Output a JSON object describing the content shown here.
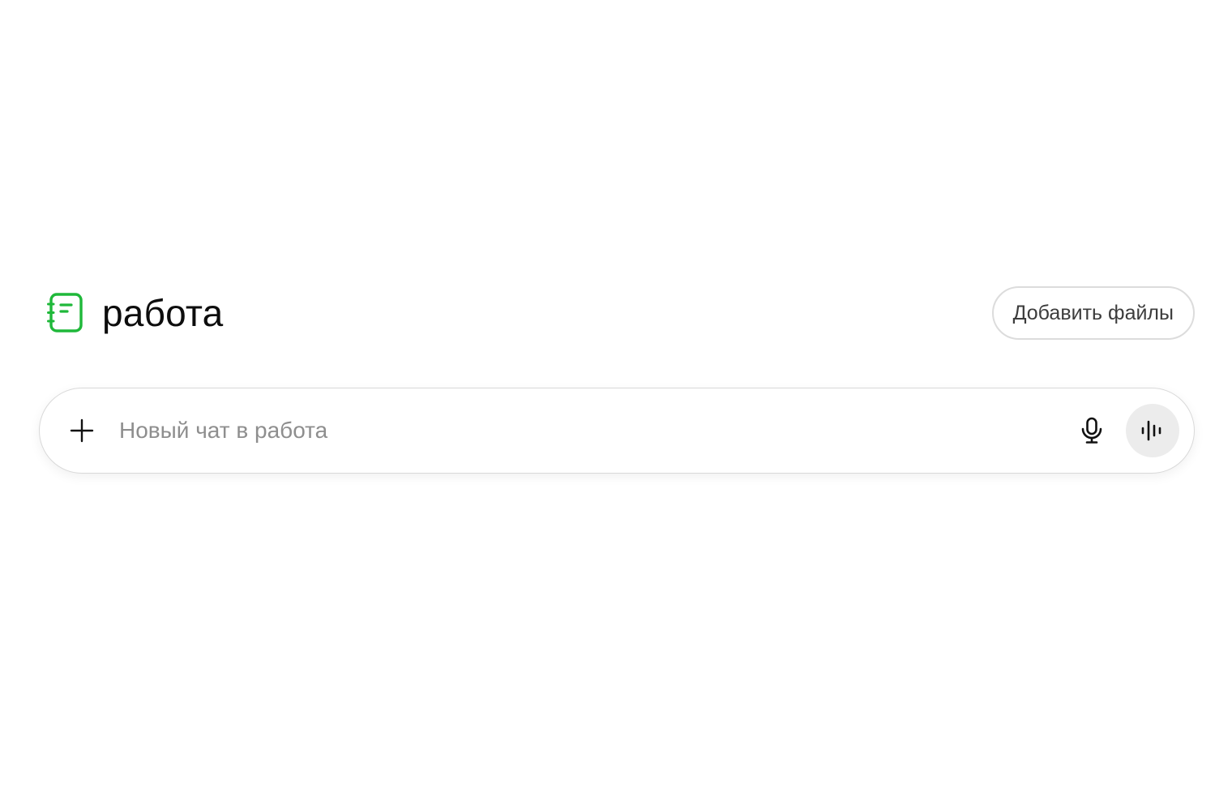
{
  "project": {
    "title": "работа",
    "icon": "notebook-icon",
    "icon_color": "#1fb83a"
  },
  "header": {
    "add_files_label": "Добавить файлы"
  },
  "composer": {
    "placeholder": "Новый чат в работа",
    "value": "",
    "plus_icon": "plus-icon",
    "mic_icon": "microphone-icon",
    "voice_icon": "voice-waveform-icon"
  }
}
